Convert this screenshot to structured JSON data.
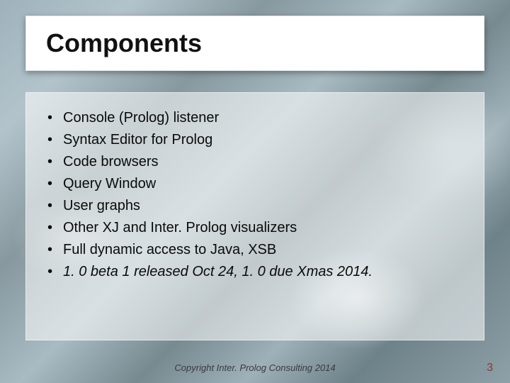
{
  "slide": {
    "title": "Components",
    "bullets": [
      {
        "text": "Console (Prolog) listener",
        "italic": false
      },
      {
        "text": "Syntax Editor for Prolog",
        "italic": false
      },
      {
        "text": "Code browsers",
        "italic": false
      },
      {
        "text": "Query Window",
        "italic": false
      },
      {
        "text": "User graphs",
        "italic": false
      },
      {
        "text": "Other XJ and Inter. Prolog visualizers",
        "italic": false
      },
      {
        "text": "Full dynamic access to Java, XSB",
        "italic": false
      },
      {
        "text": "1. 0 beta 1 released Oct 24, 1. 0 due Xmas 2014.",
        "italic": true
      }
    ],
    "footer": "Copyright Inter. Prolog Consulting 2014",
    "page_number": "3"
  }
}
